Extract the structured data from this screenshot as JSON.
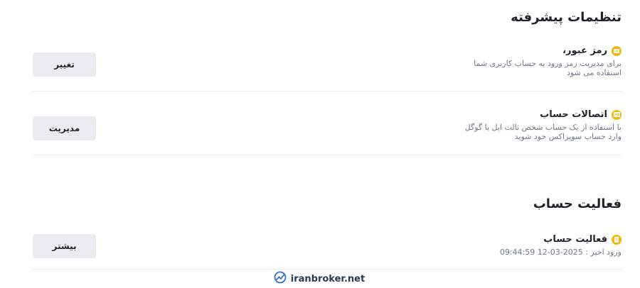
{
  "advanced": {
    "title": "تنظیمات پیشرفته",
    "items": [
      {
        "title": "رمز عبور،",
        "description": "برای مدیریت رمز ورود به حساب کاربری شما استفاده می شود",
        "button": "تغییر",
        "icon": "password-icon"
      },
      {
        "title": "اتصالات حساب",
        "description": "با استفاده از یک حساب شخص ثالث اپل یا گوگل وارد حساب سوپراکس خود شوید",
        "button": "مدیریت",
        "icon": "account-link-icon"
      }
    ]
  },
  "activity": {
    "title": "فعالیت حساب",
    "items": [
      {
        "title": "فعالیت حساب",
        "description": "ورود اخیر : 2025-03-12 09:44:59",
        "button": "بیشتر",
        "icon": "activity-icon"
      }
    ]
  },
  "watermark": {
    "text": "iranbroker.net",
    "icon": "trend-logo-icon"
  },
  "colors": {
    "accent": "#f0b90b",
    "button_bg": "#eaecef",
    "text": "#1e2329",
    "muted": "#707a8a",
    "divider": "#eaecef"
  }
}
